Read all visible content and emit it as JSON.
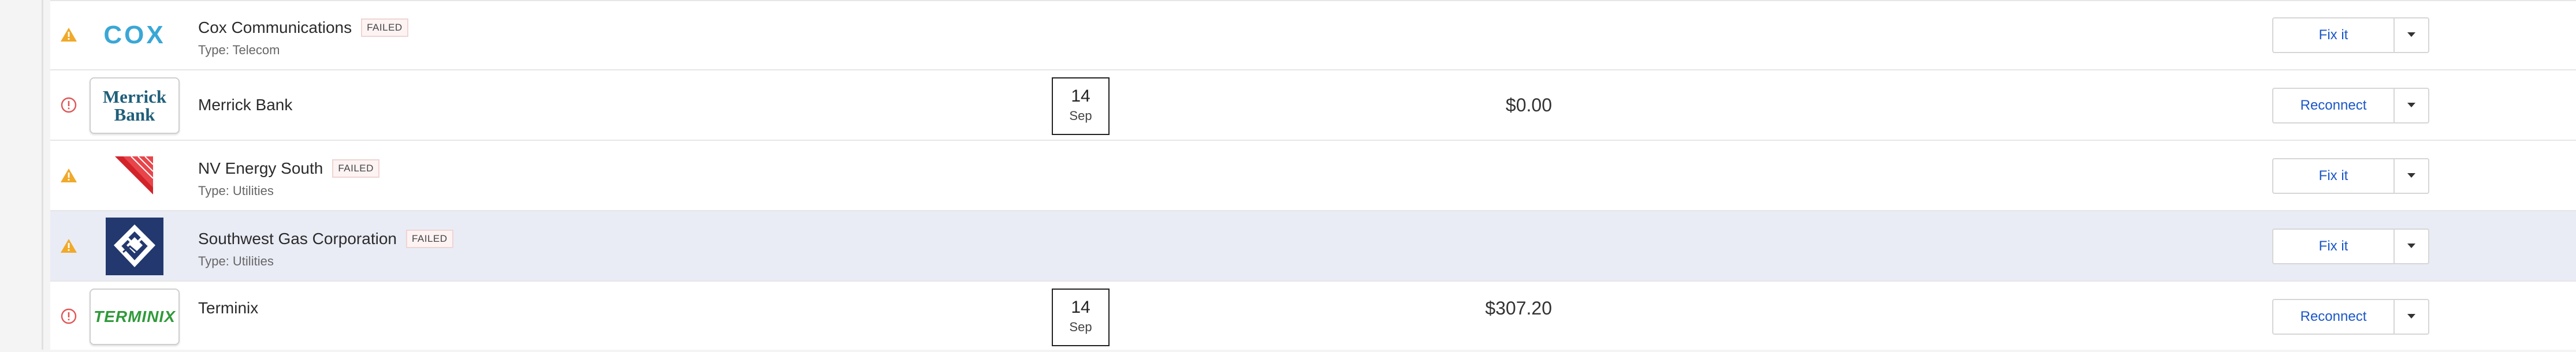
{
  "connections": [
    {
      "name": "Cox Communications",
      "badge": "FAILED",
      "type_line": "Type: Telecom",
      "status_icon": "warning-icon",
      "logo": "cox-logo",
      "logo_text": "COX",
      "action_label": "Fix it"
    },
    {
      "name": "Merrick Bank",
      "status_icon": "info-circle-icon",
      "logo": "merrick-bank-logo",
      "logo_text": [
        "Merrick",
        "Bank"
      ],
      "date_day": "14",
      "date_month": "Sep",
      "amount": "$0.00",
      "action_label": "Reconnect"
    },
    {
      "name": "NV Energy South",
      "badge": "FAILED",
      "type_line": "Type: Utilities",
      "status_icon": "warning-icon",
      "logo": "nv-energy-logo",
      "action_label": "Fix it"
    },
    {
      "name": "Southwest Gas Corporation",
      "badge": "FAILED",
      "type_line": "Type: Utilities",
      "status_icon": "warning-icon",
      "logo": "southwest-gas-logo",
      "action_label": "Fix it"
    },
    {
      "name": "Terminix",
      "status_icon": "info-circle-icon",
      "logo": "terminix-logo",
      "logo_text": "TERMINIX",
      "date_day": "14",
      "date_month": "Sep",
      "amount": "$307.20",
      "action_label": "Reconnect"
    }
  ],
  "colors": {
    "warning": "#f0a929",
    "error": "#e05555",
    "link": "#1a57c7",
    "highlight_row": "#e9ecf5",
    "cox_blue": "#3aa7d6",
    "merrick_teal": "#1f5f7a",
    "terminix_green": "#2f9a3a",
    "nv_red": "#d2232a",
    "swgas_navy": "#22386e"
  }
}
